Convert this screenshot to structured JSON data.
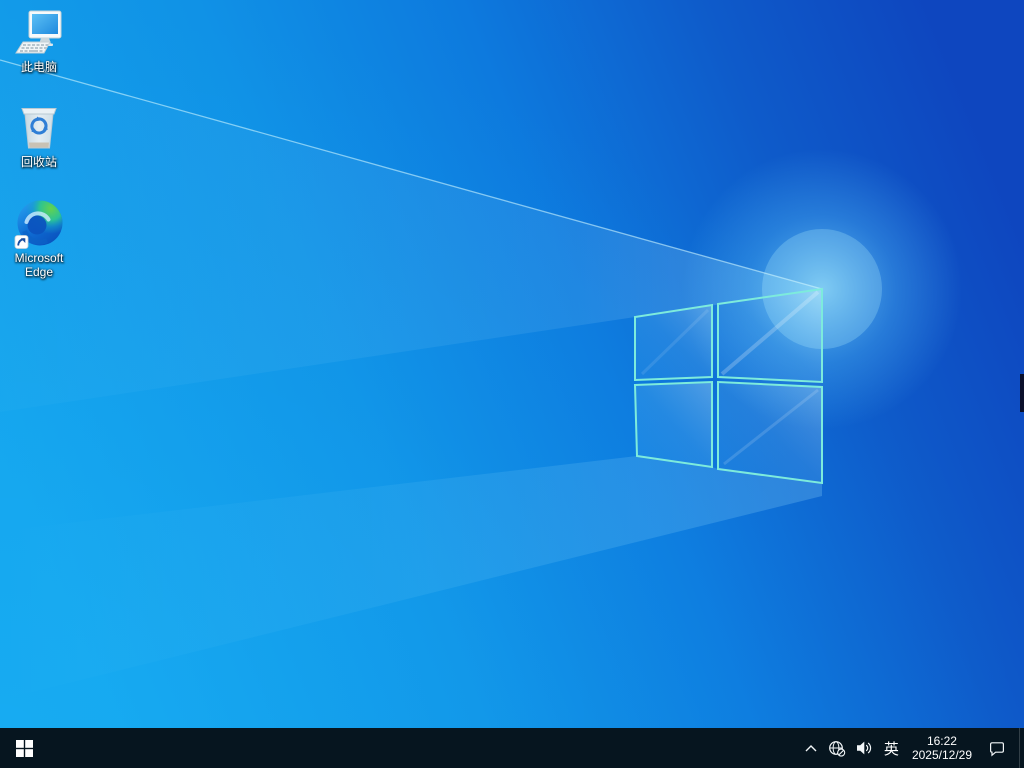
{
  "wallpaper": {
    "name": "windows-10-light-default",
    "colors": {
      "top_left": "#1b9ae6",
      "bottom_left": "#0aa6ec",
      "top_right": "#0e45bd",
      "bottom_right": "#1048bb",
      "logo_edge": "#7debdc"
    }
  },
  "desktop_icons": [
    {
      "id": "this-pc",
      "label": "此电脑"
    },
    {
      "id": "recycle-bin",
      "label": "回收站"
    },
    {
      "id": "microsoft-edge",
      "label": "Microsoft Edge"
    }
  ],
  "taskbar": {
    "background": "#06151f",
    "tray": {
      "ime_indicator": "英",
      "time": "16:22",
      "date": "2025/12/29"
    }
  }
}
